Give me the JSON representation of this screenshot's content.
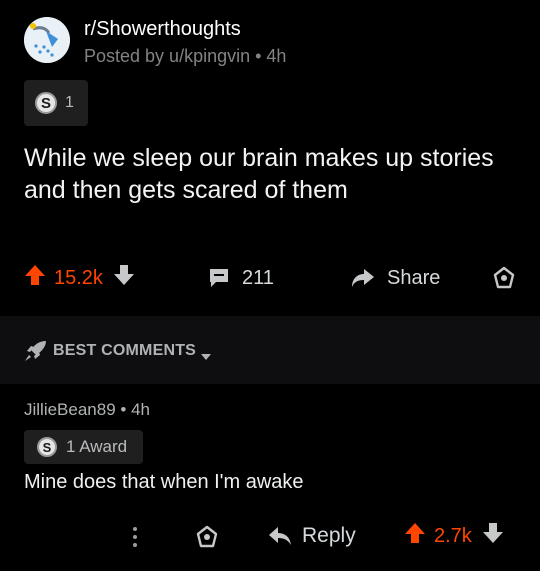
{
  "post": {
    "subreddit": "r/Showerthoughts",
    "meta": "Posted by u/kpingvin • 4h",
    "award_count": "1",
    "title": "While we sleep our brain makes up stories and then gets scared of them",
    "upvotes": "15.2k",
    "comments": "211",
    "share_label": "Share"
  },
  "sort": {
    "label": "BEST COMMENTS"
  },
  "comment": {
    "meta": "JillieBean89 • 4h",
    "award_label": "1 Award",
    "body": "Mine does that when I'm awake",
    "reply_label": "Reply",
    "upvotes": "2.7k"
  },
  "colors": {
    "upvote": "#ff4500",
    "background": "#000000",
    "band": "#0e0e10"
  },
  "icons": {
    "avatar": "shower-head-icon",
    "award": "silver-coin-icon",
    "upvote": "arrow-up-icon",
    "downvote": "arrow-down-icon",
    "comment": "speech-bubble-icon",
    "share": "share-arrow-icon",
    "give_award": "award-icon",
    "sort": "rocket-icon",
    "more": "more-vertical-icon",
    "reply": "reply-arrow-icon"
  }
}
